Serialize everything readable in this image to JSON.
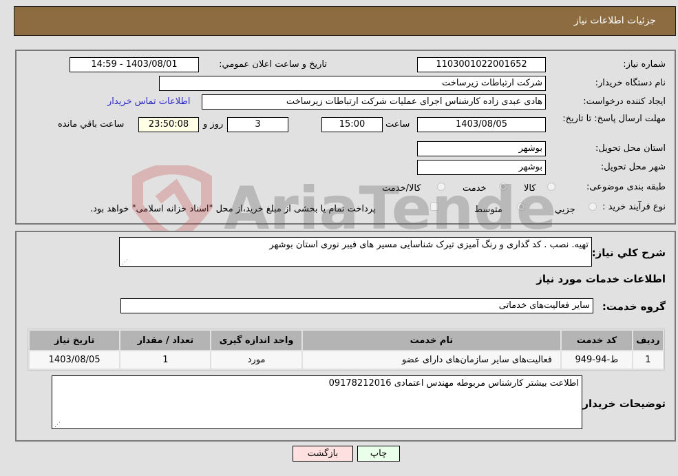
{
  "header": {
    "title": "جزئیات اطلاعات نیاز"
  },
  "details": {
    "need_number_label": "شماره نیاز:",
    "need_number": "1103001022001652",
    "announce_label": "تاریخ و ساعت اعلان عمومي:",
    "announce_value": "1403/08/01 - 14:59",
    "buyer_org_label": "نام دستگاه خریدار:",
    "buyer_org": "شرکت ارتباطات زیرساخت",
    "requester_label": "ایجاد کننده درخواست:",
    "requester": "هادی عبدی زاده کارشناس اجرای عملیات شرکت ارتباطات زیرساخت",
    "buyer_contact_link": "اطلاعات تماس خریدار",
    "deadline_label": "مهلت ارسال پاسخ: تا تاریخ:",
    "deadline_date": "1403/08/05",
    "time_label": "ساعت",
    "deadline_time": "15:00",
    "days_value": "3",
    "days_label": "روز و",
    "remaining_time": "23:50:08",
    "remaining_label": "ساعت باقي مانده",
    "province_label": "استان محل تحویل:",
    "province": "بوشهر",
    "city_label": "شهر محل تحویل:",
    "city": "بوشهر",
    "category_label": "طبقه بندی موضوعی:",
    "category_options": [
      {
        "label": "کالا",
        "selected": false
      },
      {
        "label": "خدمت",
        "selected": true
      },
      {
        "label": "کالا/خدمت",
        "selected": false
      }
    ],
    "process_label": "نوع فرآیند خرید :",
    "process_options": [
      {
        "label": "جزيي",
        "selected": false
      },
      {
        "label": "متوسط",
        "selected": true
      }
    ],
    "treasury_note": "پرداخت تمام یا بخشی از مبلغ خرید،از محل \"اسناد خزانه اسلامی\" خواهد بود."
  },
  "description": {
    "label": "شرح کلي نیاز:",
    "value": "تهیه. نصب . کد گذاری و رنگ آمیزی تیرک شناسایی مسیر های فیبر نوری استان بوشهر"
  },
  "services": {
    "section_title": "اطلاعات خدمات مورد نیاز",
    "group_label": "گروه خدمت:",
    "group_value": "سایر فعالیت‌های خدماتی",
    "columns": [
      "ردیف",
      "کد خدمت",
      "نام خدمت",
      "واحد اندازه گیری",
      "تعداد / مقدار",
      "تاریخ نیاز"
    ],
    "rows": [
      [
        "1",
        "ط-94-949",
        "فعالیت‌های سایر سازمان‌های دارای عضو",
        "مورد",
        "1",
        "1403/08/05"
      ]
    ]
  },
  "buyer_notes": {
    "label": "توضیحات خریدار:",
    "value": "اطلاعت بیشتر کارشناس مربوطه مهندس اعتمادی 09178212016"
  },
  "buttons": {
    "print": "چاپ",
    "back": "بازگشت"
  },
  "watermark": {
    "text": "AriaTender.neT"
  }
}
